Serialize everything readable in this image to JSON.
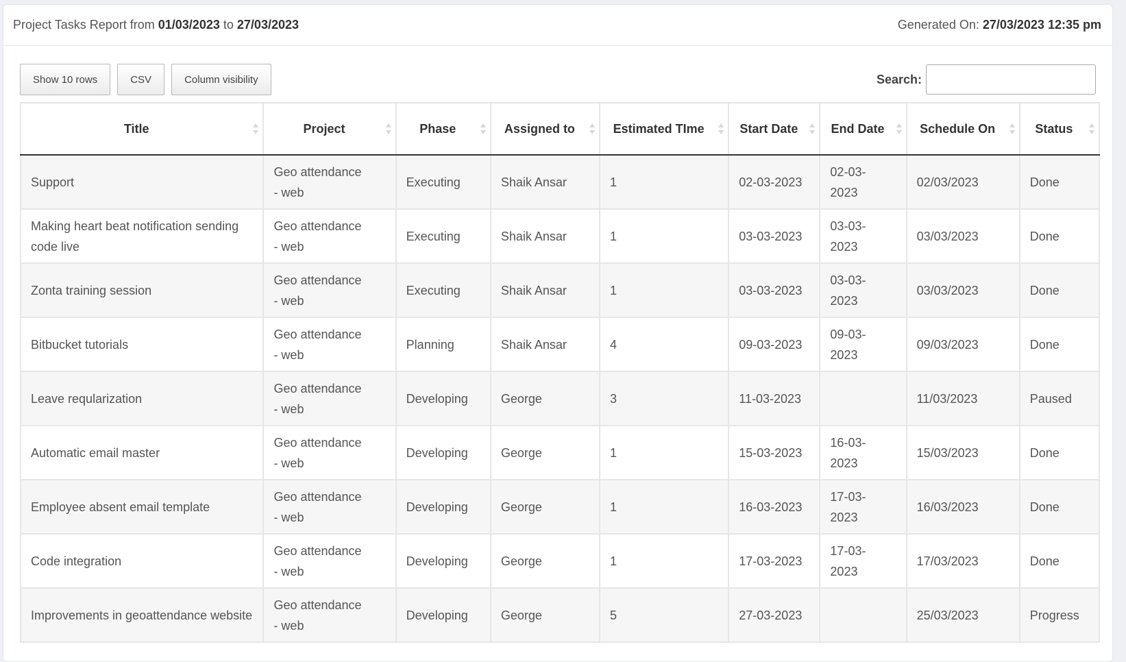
{
  "header": {
    "report_prefix": "Project Tasks Report from",
    "from_date": "01/03/2023",
    "to_word": "to",
    "to_date": "27/03/2023",
    "generated_label": "Generated On:",
    "generated_value": "27/03/2023 12:35 pm"
  },
  "toolbar": {
    "show_rows_label": "Show 10 rows",
    "csv_label": "CSV",
    "column_visibility_label": "Column visibility",
    "search_label": "Search:",
    "search_value": "",
    "search_placeholder": ""
  },
  "table": {
    "columns": [
      {
        "key": "title",
        "label": "Title",
        "sort_icon": "sort-both-icon"
      },
      {
        "key": "project",
        "label": "Project",
        "sort_icon": "sort-both-icon"
      },
      {
        "key": "phase",
        "label": "Phase",
        "sort_icon": "sort-both-icon"
      },
      {
        "key": "assigned_to",
        "label": "Assigned to",
        "sort_icon": "sort-both-icon"
      },
      {
        "key": "estimated_time",
        "label": "Estimated TIme",
        "sort_icon": "sort-both-icon"
      },
      {
        "key": "start_date",
        "label": "Start Date",
        "sort_icon": "sort-both-icon"
      },
      {
        "key": "end_date",
        "label": "End Date",
        "sort_icon": "sort-both-icon"
      },
      {
        "key": "schedule_on",
        "label": "Schedule On",
        "sort_icon": "sort-both-icon"
      },
      {
        "key": "status",
        "label": "Status",
        "sort_icon": "sort-both-icon"
      }
    ],
    "rows": [
      {
        "title": "Support",
        "project": "Geo attendance - web",
        "phase": "Executing",
        "assigned_to": "Shaik Ansar",
        "estimated_time": "1",
        "start_date": "02-03-2023",
        "end_date": "02-03-2023",
        "schedule_on": "02/03/2023",
        "status": "Done"
      },
      {
        "title": "Making heart beat notification sending code live",
        "project": "Geo attendance - web",
        "phase": "Executing",
        "assigned_to": "Shaik Ansar",
        "estimated_time": "1",
        "start_date": "03-03-2023",
        "end_date": "03-03-2023",
        "schedule_on": "03/03/2023",
        "status": "Done"
      },
      {
        "title": "Zonta training session",
        "project": "Geo attendance - web",
        "phase": "Executing",
        "assigned_to": "Shaik Ansar",
        "estimated_time": "1",
        "start_date": "03-03-2023",
        "end_date": "03-03-2023",
        "schedule_on": "03/03/2023",
        "status": "Done"
      },
      {
        "title": "Bitbucket tutorials",
        "project": "Geo attendance - web",
        "phase": "Planning",
        "assigned_to": "Shaik Ansar",
        "estimated_time": "4",
        "start_date": "09-03-2023",
        "end_date": "09-03-2023",
        "schedule_on": "09/03/2023",
        "status": "Done"
      },
      {
        "title": "Leave reqularization",
        "project": "Geo attendance - web",
        "phase": "Developing",
        "assigned_to": "George",
        "estimated_time": "3",
        "start_date": "11-03-2023",
        "end_date": "",
        "schedule_on": "11/03/2023",
        "status": "Paused"
      },
      {
        "title": "Automatic email master",
        "project": "Geo attendance - web",
        "phase": "Developing",
        "assigned_to": "George",
        "estimated_time": "1",
        "start_date": "15-03-2023",
        "end_date": "16-03-2023",
        "schedule_on": "15/03/2023",
        "status": "Done"
      },
      {
        "title": "Employee absent email template",
        "project": "Geo attendance - web",
        "phase": "Developing",
        "assigned_to": "George",
        "estimated_time": "1",
        "start_date": "16-03-2023",
        "end_date": "17-03-2023",
        "schedule_on": "16/03/2023",
        "status": "Done"
      },
      {
        "title": "Code integration",
        "project": "Geo attendance - web",
        "phase": "Developing",
        "assigned_to": "George",
        "estimated_time": "1",
        "start_date": "17-03-2023",
        "end_date": "17-03-2023",
        "schedule_on": "17/03/2023",
        "status": "Done"
      },
      {
        "title": "Improvements in geoattendance website",
        "project": "Geo attendance - web",
        "phase": "Developing",
        "assigned_to": "George",
        "estimated_time": "5",
        "start_date": "27-03-2023",
        "end_date": "",
        "schedule_on": "25/03/2023",
        "status": "Progress"
      }
    ]
  }
}
